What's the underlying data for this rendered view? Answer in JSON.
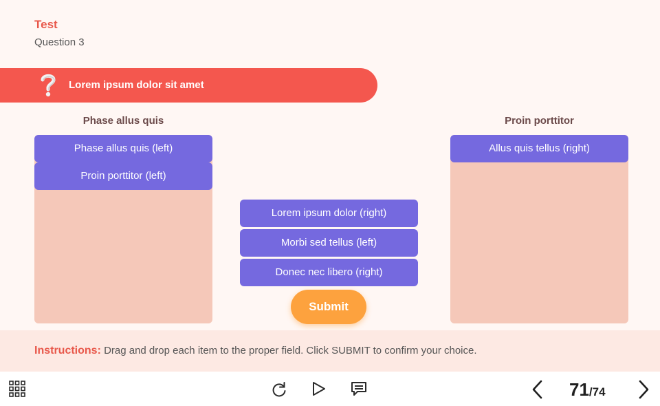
{
  "header": {
    "title": "Test",
    "subtitle": "Question 3"
  },
  "question": {
    "text": "Lorem ipsum dolor sit amet",
    "icon": "question-mark-icon"
  },
  "zones": {
    "left": {
      "label": "Phase allus quis",
      "items": [
        "Phase allus quis (left)",
        "Proin porttitor (left)"
      ]
    },
    "right": {
      "label": "Proin porttitor",
      "items": [
        "Allus quis tellus (right)"
      ]
    }
  },
  "pool": {
    "items": [
      "Lorem ipsum dolor (right)",
      "Morbi sed tellus (left)",
      "Donec nec libero (right)"
    ]
  },
  "submit_label": "Submit",
  "instructions": {
    "label": "Instructions:",
    "text": "Drag and drop each item to the proper field. Click SUBMIT to confirm your choice."
  },
  "nav": {
    "menu_icon": "grid-menu-icon",
    "replay_icon": "replay-icon",
    "play_icon": "play-icon",
    "notes_icon": "notes-icon",
    "prev_icon": "chevron-left-icon",
    "next_icon": "chevron-right-icon",
    "current_page": "71",
    "total_pages": "/74"
  },
  "colors": {
    "accent": "#f4574e",
    "item": "#7569df",
    "zone": "#f5c8b9",
    "submit": "#fda23e",
    "background": "#fff7f4"
  }
}
